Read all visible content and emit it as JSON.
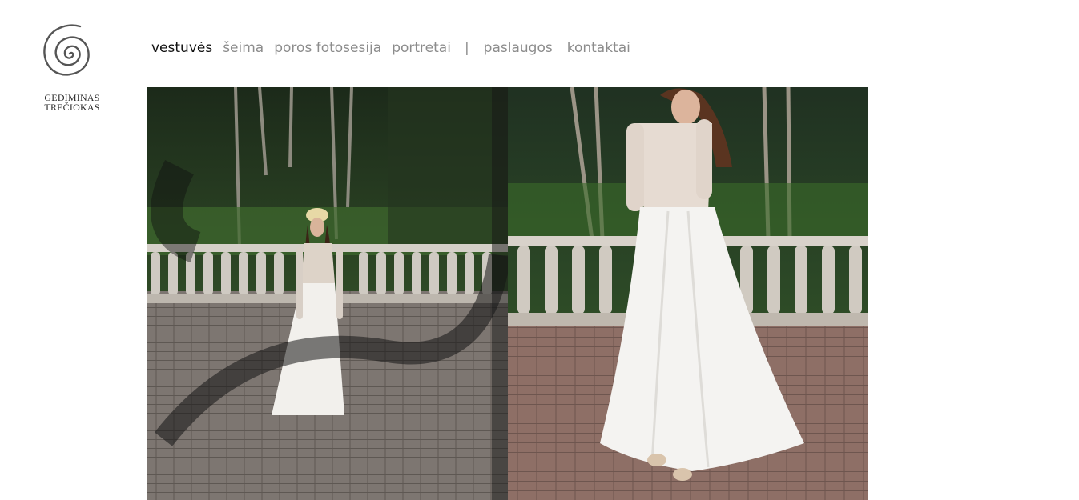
{
  "brand": {
    "line1": "GEDIMINAS",
    "line2": "TREČIOKAS"
  },
  "nav": {
    "items": [
      {
        "label": "vestuvės",
        "active": true
      },
      {
        "label": "šeima",
        "active": false
      },
      {
        "label": "poros fotosesija",
        "active": false
      },
      {
        "label": "portretai",
        "active": false
      },
      {
        "label": "|",
        "separator": true
      },
      {
        "label": "paslaugos",
        "active": false
      },
      {
        "label": "kontaktai",
        "active": false
      }
    ]
  },
  "colors": {
    "nav_active": "#111111",
    "nav_inactive": "#8c8c8c",
    "logo": "#555555"
  },
  "gallery": {
    "photos": [
      "bride-photo-left",
      "bride-photo-right"
    ]
  }
}
